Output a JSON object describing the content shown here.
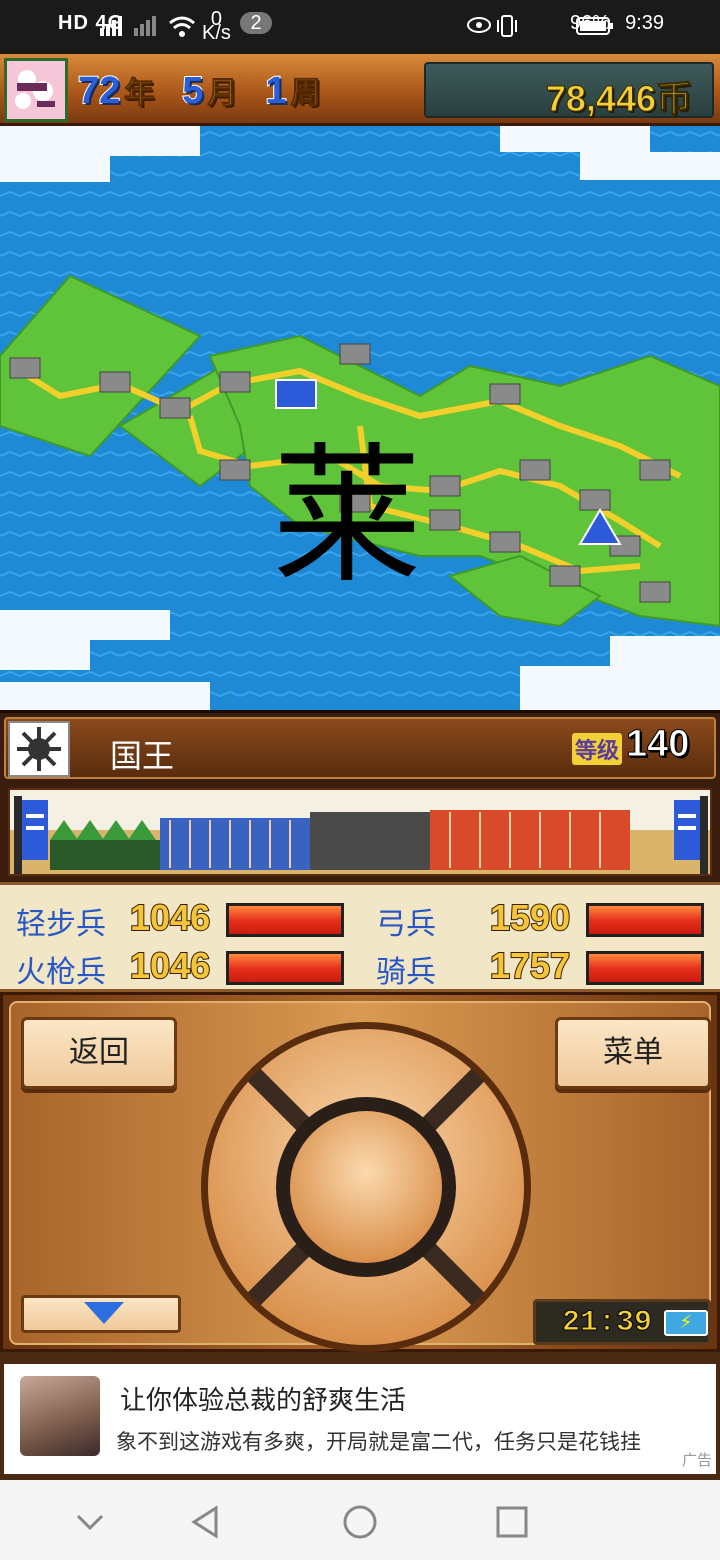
{
  "status_bar": {
    "network_left": "HD 4G",
    "speed_value": "0",
    "speed_unit": "K/s",
    "notification_count": "2",
    "battery": "96%",
    "time": "9:39"
  },
  "header": {
    "year": "72",
    "year_unit": "年",
    "month": "5",
    "month_unit": "月",
    "week": "1",
    "week_unit": "周",
    "money": "78,446币"
  },
  "map": {
    "overlay_glyph": "莱"
  },
  "character": {
    "name": "国王",
    "level_label": "等级",
    "level": "140"
  },
  "troops": [
    {
      "label": "轻步兵",
      "value": "1046",
      "fill": 1.0
    },
    {
      "label": "弓兵",
      "value": "1590",
      "fill": 1.0
    },
    {
      "label": "火枪兵",
      "value": "1046",
      "fill": 1.0
    },
    {
      "label": "骑兵",
      "value": "1757",
      "fill": 1.0
    }
  ],
  "controls": {
    "back_label": "返回",
    "menu_label": "菜单",
    "game_clock": "21:39"
  },
  "ad": {
    "title": "让你体验总裁的舒爽生活",
    "description": "象不到这游戏有多爽，开局就是富二代，任务只是花钱挂",
    "tag": "广告"
  },
  "colors": {
    "sea": "#1e8ad6",
    "land": "#5fc43a",
    "road": "#f2cf2a",
    "troop_label": "#2a57c6"
  }
}
